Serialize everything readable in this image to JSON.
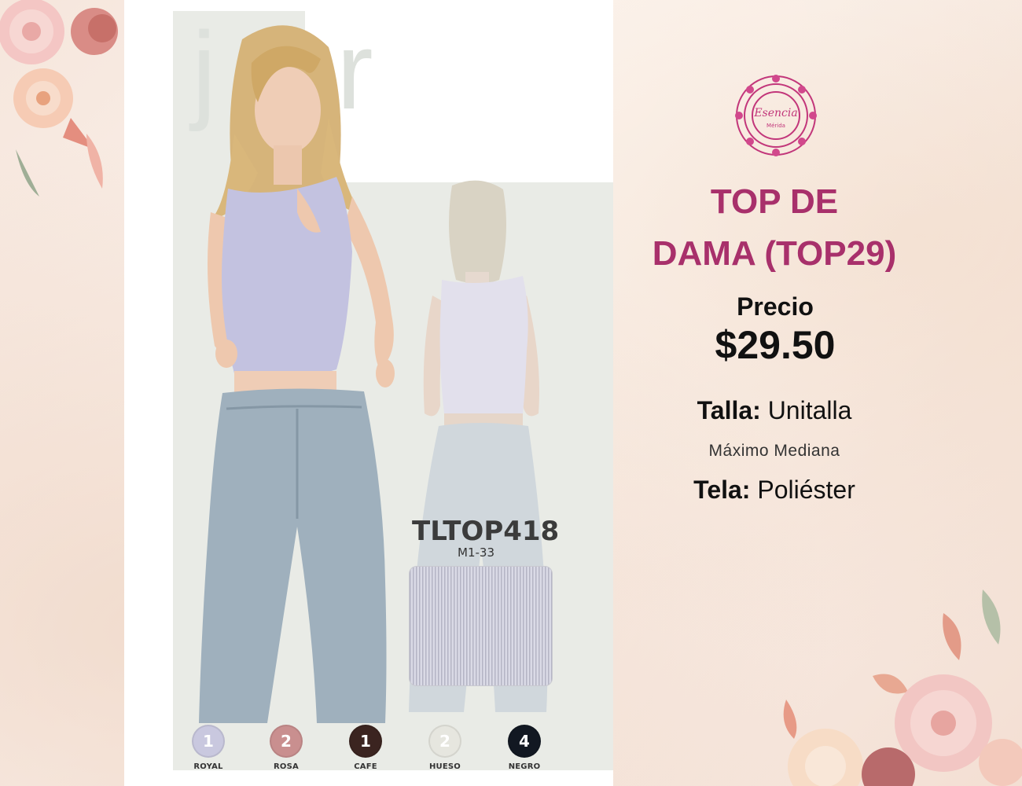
{
  "product": {
    "title_line1": "TOP DE",
    "title_line2": "DAMA (TOP29)",
    "price_label": "Precio",
    "price_value": "$29.50",
    "size_label": "Talla:",
    "size_value": "Unitalla",
    "size_note": "Máximo Mediana",
    "fabric_label": "Tela:",
    "fabric_value": "Poliéster"
  },
  "brand": {
    "logo_text": "Esencia",
    "logo_subtext": "Mérida"
  },
  "catalog": {
    "code": "TLTOP418",
    "sub_code": "M1-33",
    "colors": [
      {
        "count": "1",
        "name": "ROYAL",
        "color": "#c9c8df",
        "text_color": "#ffffff"
      },
      {
        "count": "2",
        "name": "ROSA",
        "color": "#c98f8f",
        "text_color": "#ffffff"
      },
      {
        "count": "1",
        "name": "CAFE",
        "color": "#3b2420",
        "text_color": "#ffffff"
      },
      {
        "count": "2",
        "name": "HUESO",
        "color": "#e6e6df",
        "text_color": "#ffffff"
      },
      {
        "count": "4",
        "name": "NEGRO",
        "color": "#121822",
        "text_color": "#ffffff"
      }
    ]
  },
  "theme": {
    "accent": "#a8306b",
    "top_color": "#c3c2e0",
    "jeans_color": "#9fb0bd"
  }
}
